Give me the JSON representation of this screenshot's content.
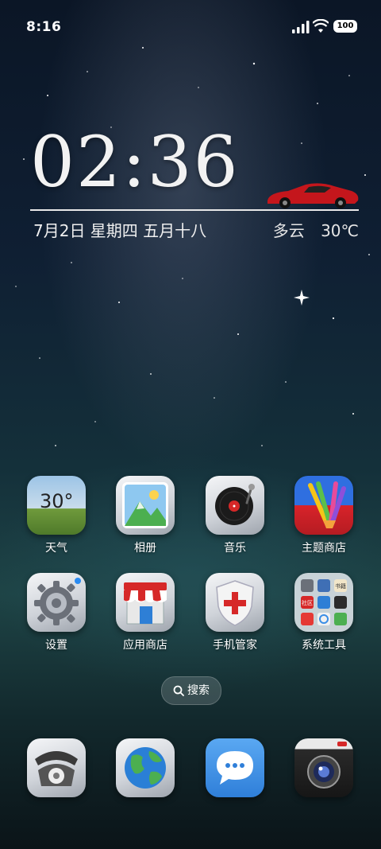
{
  "status_bar": {
    "time": "8:16",
    "battery": "100"
  },
  "clock_widget": {
    "time": "02:36",
    "date": "7月2日 星期四 五月十八",
    "weather_condition": "多云",
    "temperature": "30℃"
  },
  "apps": {
    "row1": [
      {
        "label": "天气",
        "icon_text": "30°",
        "icon": "weather-icon"
      },
      {
        "label": "相册",
        "icon": "gallery-icon"
      },
      {
        "label": "音乐",
        "icon": "music-icon"
      },
      {
        "label": "主题商店",
        "icon": "theme-store-icon"
      }
    ],
    "row2": [
      {
        "label": "设置",
        "icon": "settings-icon"
      },
      {
        "label": "应用商店",
        "icon": "app-store-icon"
      },
      {
        "label": "手机管家",
        "icon": "security-icon"
      },
      {
        "label": "系统工具",
        "icon": "system-tools-folder-icon",
        "folder_tile_text": [
          "书籍",
          "社区"
        ]
      }
    ]
  },
  "search": {
    "label": "搜索"
  },
  "dock": [
    {
      "icon": "phone-icon"
    },
    {
      "icon": "browser-icon"
    },
    {
      "icon": "messages-icon"
    },
    {
      "icon": "camera-icon"
    }
  ],
  "colors": {
    "accent_red": "#d62828",
    "weather_sky": "#8fb6d9",
    "message_blue": "#3a8ee6"
  }
}
